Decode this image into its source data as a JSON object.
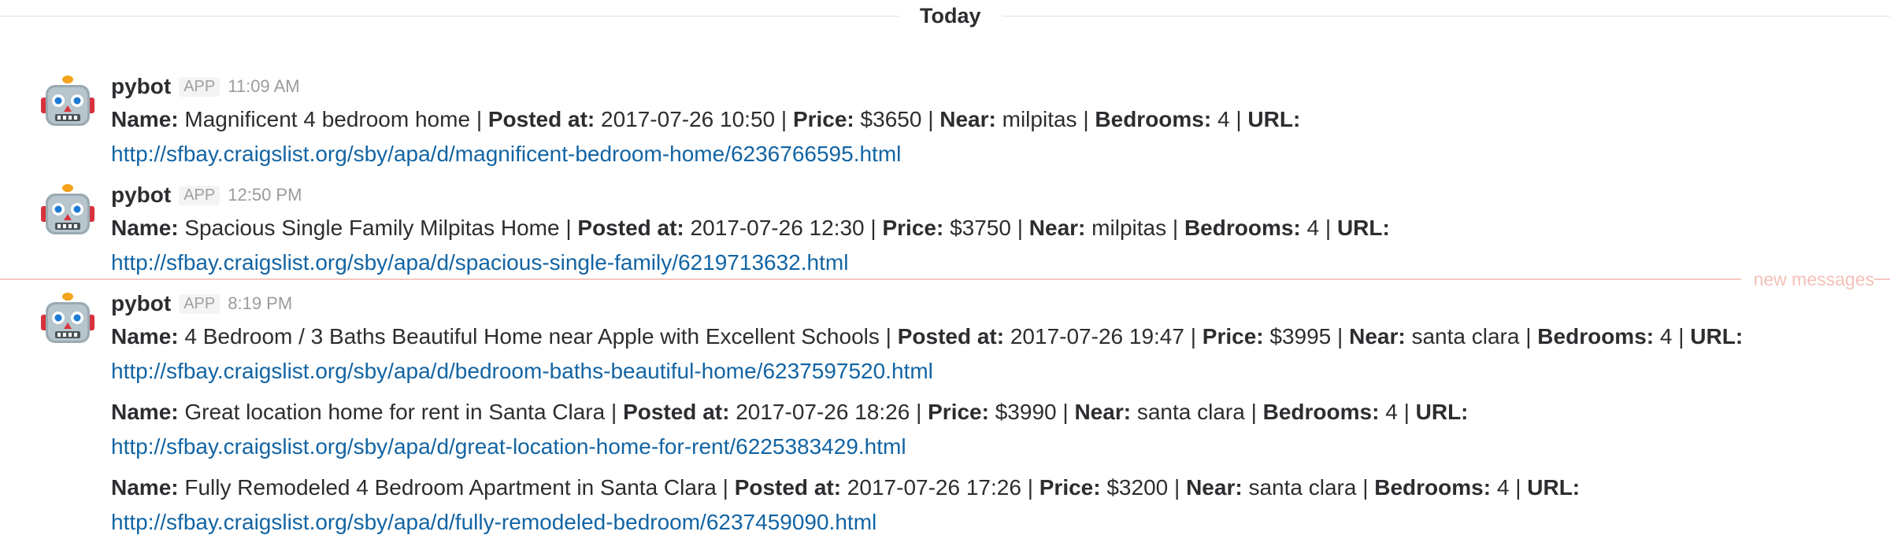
{
  "day_divider": "Today",
  "new_messages_label": "new messages",
  "groups": [
    {
      "sender": "pybot",
      "badge": "APP",
      "time": "11:09 AM",
      "messages": [
        {
          "name": "Magnificent 4 bedroom home",
          "posted": "2017-07-26 10:50",
          "price": "$3650",
          "near": "milpitas",
          "bedrooms": "4",
          "url": "http://sfbay.craigslist.org/sby/apa/d/magnificent-bedroom-home/6236766595.html"
        }
      ]
    },
    {
      "sender": "pybot",
      "badge": "APP",
      "time": "12:50 PM",
      "messages": [
        {
          "name": "Spacious Single Family Milpitas Home",
          "posted": "2017-07-26 12:30",
          "price": "$3750",
          "near": "milpitas",
          "bedrooms": "4",
          "url": "http://sfbay.craigslist.org/sby/apa/d/spacious-single-family/6219713632.html"
        }
      ]
    },
    {
      "sender": "pybot",
      "badge": "APP",
      "time": "8:19 PM",
      "messages": [
        {
          "name": "4 Bedroom / 3 Baths Beautiful Home near Apple with Excellent Schools",
          "posted": "2017-07-26 19:47",
          "price": "$3995",
          "near": "santa clara",
          "bedrooms": "4",
          "url": "http://sfbay.craigslist.org/sby/apa/d/bedroom-baths-beautiful-home/6237597520.html"
        },
        {
          "name": "Great location home for rent in Santa Clara",
          "posted": "2017-07-26 18:26",
          "price": "$3990",
          "near": "santa clara",
          "bedrooms": "4",
          "url": "http://sfbay.craigslist.org/sby/apa/d/great-location-home-for-rent/6225383429.html"
        },
        {
          "name": "Fully Remodeled 4 Bedroom Apartment in Santa Clara",
          "posted": "2017-07-26 17:26",
          "price": "$3200",
          "near": "santa clara",
          "bedrooms": "4",
          "url": "http://sfbay.craigslist.org/sby/apa/d/fully-remodeled-bedroom/6237459090.html"
        }
      ]
    }
  ],
  "field_labels": {
    "name": "Name:",
    "posted": "Posted at:",
    "price": "Price:",
    "near": "Near:",
    "bedrooms": "Bedrooms:",
    "url": "URL:",
    "sep": "|"
  }
}
